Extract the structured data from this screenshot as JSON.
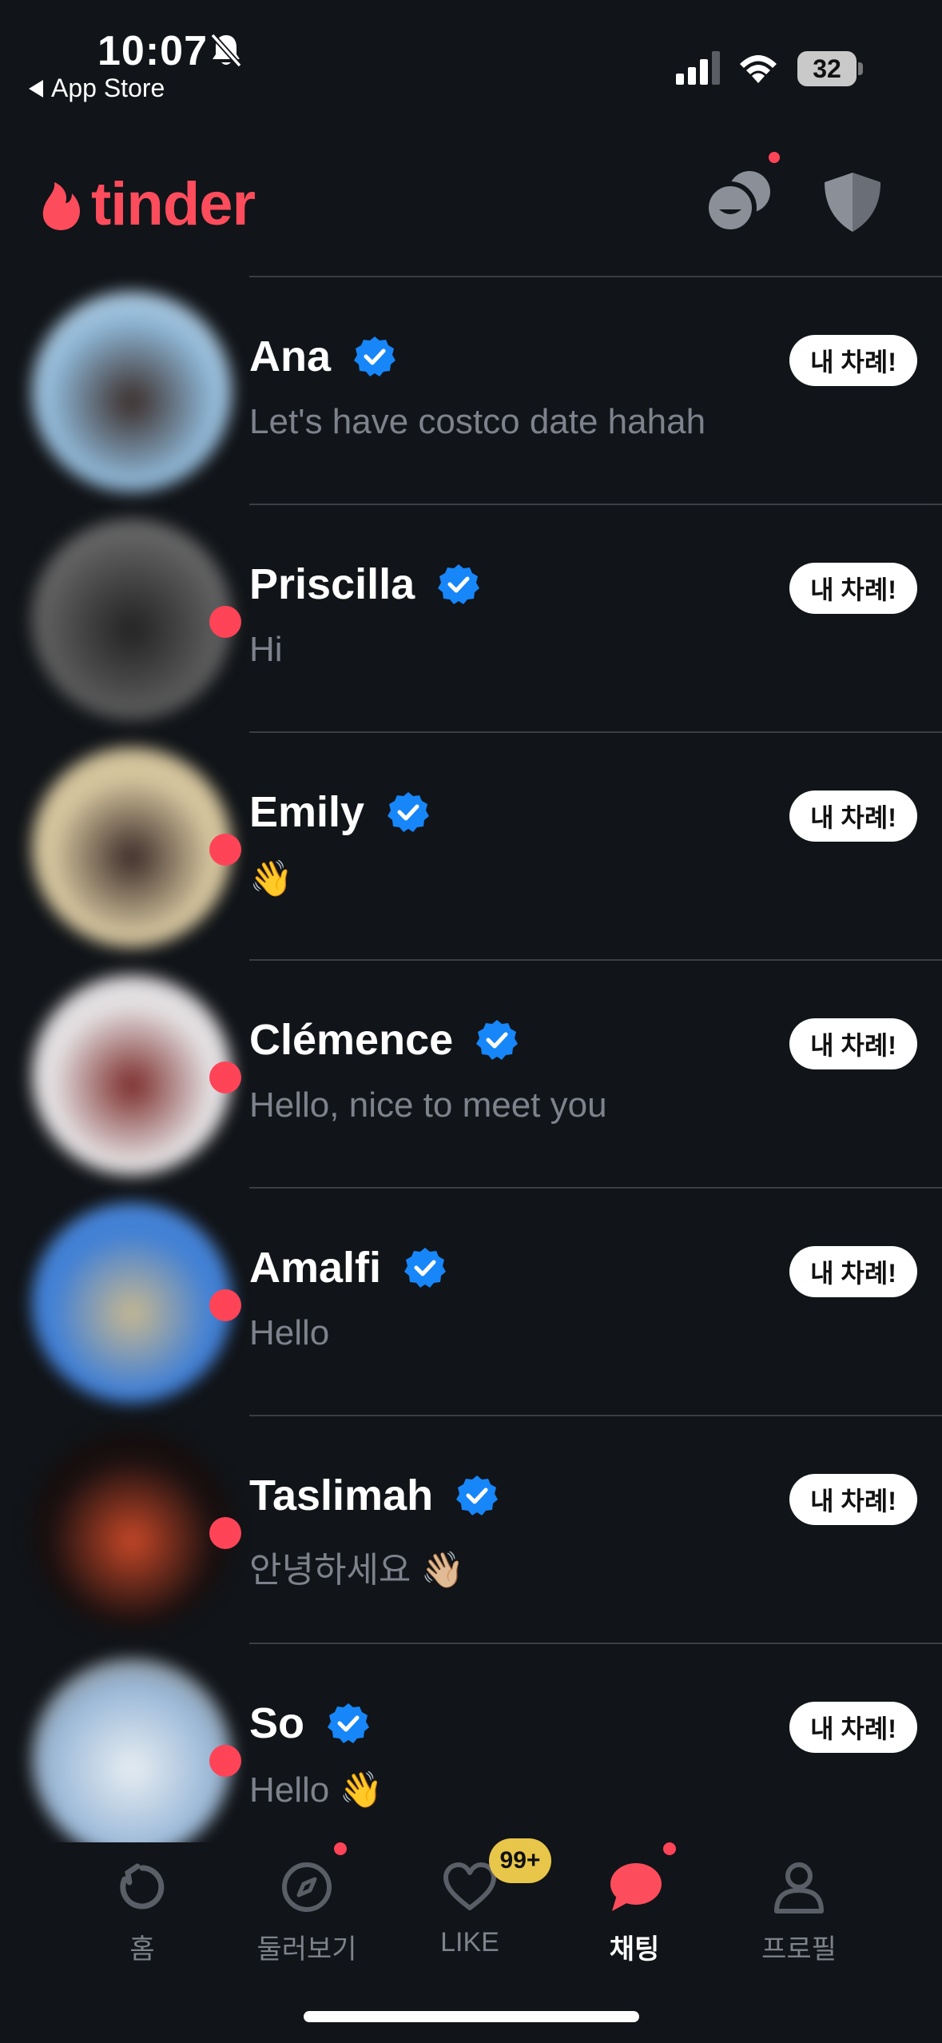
{
  "status_bar": {
    "time": "10:07",
    "back_label": "App Store",
    "battery": "32"
  },
  "header": {
    "logo": "tinder"
  },
  "conversations": [
    {
      "name": "Ana",
      "message": "Let's have costco date hahah",
      "badge": "내 차례!",
      "unread": false,
      "avatar_colors": [
        "#8fb8d8",
        "#3a2c28",
        "#e0e6ea"
      ]
    },
    {
      "name": "Priscilla",
      "message": "Hi",
      "badge": "내 차례!",
      "unread": true,
      "avatar_colors": [
        "#5a5a5a",
        "#222222",
        "#888888"
      ]
    },
    {
      "name": "Emily",
      "message": "👋",
      "badge": "내 차례!",
      "unread": true,
      "avatar_colors": [
        "#d8c8a0",
        "#3a2a28",
        "#bfb08a"
      ]
    },
    {
      "name": "Clémence",
      "message": "Hello, nice to meet you",
      "badge": "내 차례!",
      "unread": true,
      "avatar_colors": [
        "#e6e4e6",
        "#7a2a28",
        "#c8c0c4"
      ]
    },
    {
      "name": "Amalfi",
      "message": "Hello",
      "badge": "내 차례!",
      "unread": true,
      "avatar_colors": [
        "#3f7fd6",
        "#c8b890",
        "#5a90d8"
      ]
    },
    {
      "name": "Taslimah",
      "message": "안녕하세요 👋🏼",
      "badge": "내 차례!",
      "unread": true,
      "avatar_colors": [
        "#1a1010",
        "#c84828",
        "#0a0808"
      ]
    },
    {
      "name": "So",
      "message": "Hello 👋",
      "badge": "내 차례!",
      "unread": true,
      "avatar_colors": [
        "#9ab8d8",
        "#e8eef2",
        "#7a6850"
      ]
    }
  ],
  "tabs": [
    {
      "id": "home",
      "label": "홈",
      "active": false,
      "dot": false
    },
    {
      "id": "explore",
      "label": "둘러보기",
      "active": false,
      "dot": true
    },
    {
      "id": "likes",
      "label": "LIKE",
      "active": false,
      "dot": false
    },
    {
      "id": "chat",
      "label": "채팅",
      "active": true,
      "dot": true
    },
    {
      "id": "profile",
      "label": "프로필",
      "active": false,
      "dot": false
    }
  ],
  "likes_badge": "99+",
  "colors": {
    "background": "#111418",
    "brand": "#fd4c5c",
    "unread_dot": "#ff4458",
    "verified": "#1786f8",
    "likes_badge": "#e8c64a"
  }
}
